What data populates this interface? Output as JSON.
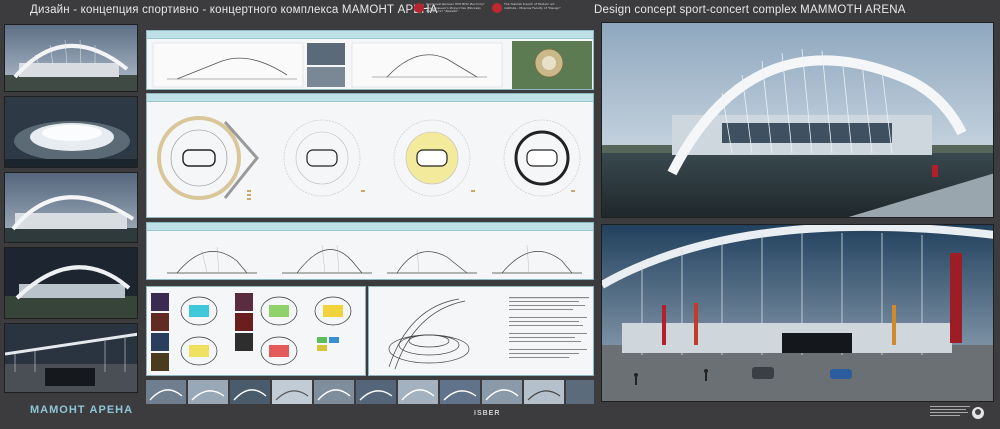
{
  "header": {
    "title_ru": "Дизайн - концепция спортивно - концертного комплекса МАМОНТ АРЕНА",
    "title_en": "Design concept sport-concert complex MAMMOTH ARENA",
    "institute_ru": "Якутский филиал НОУ ВПО Институт Современного Искусства (Москва) Факультет \"Дизайн\"",
    "institute_en": "The Yakutsk branch of Modern art institute - Moscow Faculty of \"Design\""
  },
  "logo_bottom_left": "МАМОНТ АРЕНА",
  "logo_bottom_center": "ISBER",
  "colors": {
    "background": "#3c3c3e",
    "panel_header": "#bfe0e6",
    "panel_border": "#8fb7c2",
    "flag_red": "#b3202a",
    "sky_light": "#c6d7e3"
  }
}
